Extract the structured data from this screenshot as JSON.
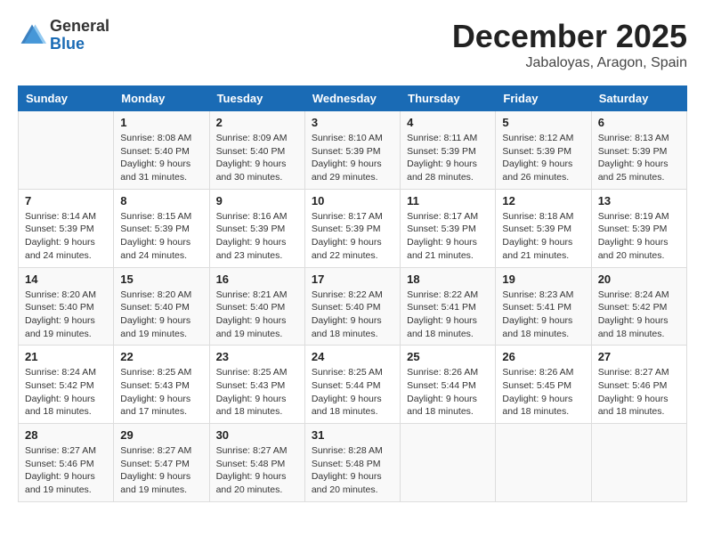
{
  "header": {
    "logo_general": "General",
    "logo_blue": "Blue",
    "month_title": "December 2025",
    "location": "Jabaloyas, Aragon, Spain"
  },
  "days_of_week": [
    "Sunday",
    "Monday",
    "Tuesday",
    "Wednesday",
    "Thursday",
    "Friday",
    "Saturday"
  ],
  "weeks": [
    [
      {
        "day": "",
        "sunrise": "",
        "sunset": "",
        "daylight": ""
      },
      {
        "day": "1",
        "sunrise": "Sunrise: 8:08 AM",
        "sunset": "Sunset: 5:40 PM",
        "daylight": "Daylight: 9 hours and 31 minutes."
      },
      {
        "day": "2",
        "sunrise": "Sunrise: 8:09 AM",
        "sunset": "Sunset: 5:40 PM",
        "daylight": "Daylight: 9 hours and 30 minutes."
      },
      {
        "day": "3",
        "sunrise": "Sunrise: 8:10 AM",
        "sunset": "Sunset: 5:39 PM",
        "daylight": "Daylight: 9 hours and 29 minutes."
      },
      {
        "day": "4",
        "sunrise": "Sunrise: 8:11 AM",
        "sunset": "Sunset: 5:39 PM",
        "daylight": "Daylight: 9 hours and 28 minutes."
      },
      {
        "day": "5",
        "sunrise": "Sunrise: 8:12 AM",
        "sunset": "Sunset: 5:39 PM",
        "daylight": "Daylight: 9 hours and 26 minutes."
      },
      {
        "day": "6",
        "sunrise": "Sunrise: 8:13 AM",
        "sunset": "Sunset: 5:39 PM",
        "daylight": "Daylight: 9 hours and 25 minutes."
      }
    ],
    [
      {
        "day": "7",
        "sunrise": "Sunrise: 8:14 AM",
        "sunset": "Sunset: 5:39 PM",
        "daylight": "Daylight: 9 hours and 24 minutes."
      },
      {
        "day": "8",
        "sunrise": "Sunrise: 8:15 AM",
        "sunset": "Sunset: 5:39 PM",
        "daylight": "Daylight: 9 hours and 24 minutes."
      },
      {
        "day": "9",
        "sunrise": "Sunrise: 8:16 AM",
        "sunset": "Sunset: 5:39 PM",
        "daylight": "Daylight: 9 hours and 23 minutes."
      },
      {
        "day": "10",
        "sunrise": "Sunrise: 8:17 AM",
        "sunset": "Sunset: 5:39 PM",
        "daylight": "Daylight: 9 hours and 22 minutes."
      },
      {
        "day": "11",
        "sunrise": "Sunrise: 8:17 AM",
        "sunset": "Sunset: 5:39 PM",
        "daylight": "Daylight: 9 hours and 21 minutes."
      },
      {
        "day": "12",
        "sunrise": "Sunrise: 8:18 AM",
        "sunset": "Sunset: 5:39 PM",
        "daylight": "Daylight: 9 hours and 21 minutes."
      },
      {
        "day": "13",
        "sunrise": "Sunrise: 8:19 AM",
        "sunset": "Sunset: 5:39 PM",
        "daylight": "Daylight: 9 hours and 20 minutes."
      }
    ],
    [
      {
        "day": "14",
        "sunrise": "Sunrise: 8:20 AM",
        "sunset": "Sunset: 5:40 PM",
        "daylight": "Daylight: 9 hours and 19 minutes."
      },
      {
        "day": "15",
        "sunrise": "Sunrise: 8:20 AM",
        "sunset": "Sunset: 5:40 PM",
        "daylight": "Daylight: 9 hours and 19 minutes."
      },
      {
        "day": "16",
        "sunrise": "Sunrise: 8:21 AM",
        "sunset": "Sunset: 5:40 PM",
        "daylight": "Daylight: 9 hours and 19 minutes."
      },
      {
        "day": "17",
        "sunrise": "Sunrise: 8:22 AM",
        "sunset": "Sunset: 5:40 PM",
        "daylight": "Daylight: 9 hours and 18 minutes."
      },
      {
        "day": "18",
        "sunrise": "Sunrise: 8:22 AM",
        "sunset": "Sunset: 5:41 PM",
        "daylight": "Daylight: 9 hours and 18 minutes."
      },
      {
        "day": "19",
        "sunrise": "Sunrise: 8:23 AM",
        "sunset": "Sunset: 5:41 PM",
        "daylight": "Daylight: 9 hours and 18 minutes."
      },
      {
        "day": "20",
        "sunrise": "Sunrise: 8:24 AM",
        "sunset": "Sunset: 5:42 PM",
        "daylight": "Daylight: 9 hours and 18 minutes."
      }
    ],
    [
      {
        "day": "21",
        "sunrise": "Sunrise: 8:24 AM",
        "sunset": "Sunset: 5:42 PM",
        "daylight": "Daylight: 9 hours and 18 minutes."
      },
      {
        "day": "22",
        "sunrise": "Sunrise: 8:25 AM",
        "sunset": "Sunset: 5:43 PM",
        "daylight": "Daylight: 9 hours and 17 minutes."
      },
      {
        "day": "23",
        "sunrise": "Sunrise: 8:25 AM",
        "sunset": "Sunset: 5:43 PM",
        "daylight": "Daylight: 9 hours and 18 minutes."
      },
      {
        "day": "24",
        "sunrise": "Sunrise: 8:25 AM",
        "sunset": "Sunset: 5:44 PM",
        "daylight": "Daylight: 9 hours and 18 minutes."
      },
      {
        "day": "25",
        "sunrise": "Sunrise: 8:26 AM",
        "sunset": "Sunset: 5:44 PM",
        "daylight": "Daylight: 9 hours and 18 minutes."
      },
      {
        "day": "26",
        "sunrise": "Sunrise: 8:26 AM",
        "sunset": "Sunset: 5:45 PM",
        "daylight": "Daylight: 9 hours and 18 minutes."
      },
      {
        "day": "27",
        "sunrise": "Sunrise: 8:27 AM",
        "sunset": "Sunset: 5:46 PM",
        "daylight": "Daylight: 9 hours and 18 minutes."
      }
    ],
    [
      {
        "day": "28",
        "sunrise": "Sunrise: 8:27 AM",
        "sunset": "Sunset: 5:46 PM",
        "daylight": "Daylight: 9 hours and 19 minutes."
      },
      {
        "day": "29",
        "sunrise": "Sunrise: 8:27 AM",
        "sunset": "Sunset: 5:47 PM",
        "daylight": "Daylight: 9 hours and 19 minutes."
      },
      {
        "day": "30",
        "sunrise": "Sunrise: 8:27 AM",
        "sunset": "Sunset: 5:48 PM",
        "daylight": "Daylight: 9 hours and 20 minutes."
      },
      {
        "day": "31",
        "sunrise": "Sunrise: 8:28 AM",
        "sunset": "Sunset: 5:48 PM",
        "daylight": "Daylight: 9 hours and 20 minutes."
      },
      {
        "day": "",
        "sunrise": "",
        "sunset": "",
        "daylight": ""
      },
      {
        "day": "",
        "sunrise": "",
        "sunset": "",
        "daylight": ""
      },
      {
        "day": "",
        "sunrise": "",
        "sunset": "",
        "daylight": ""
      }
    ]
  ]
}
